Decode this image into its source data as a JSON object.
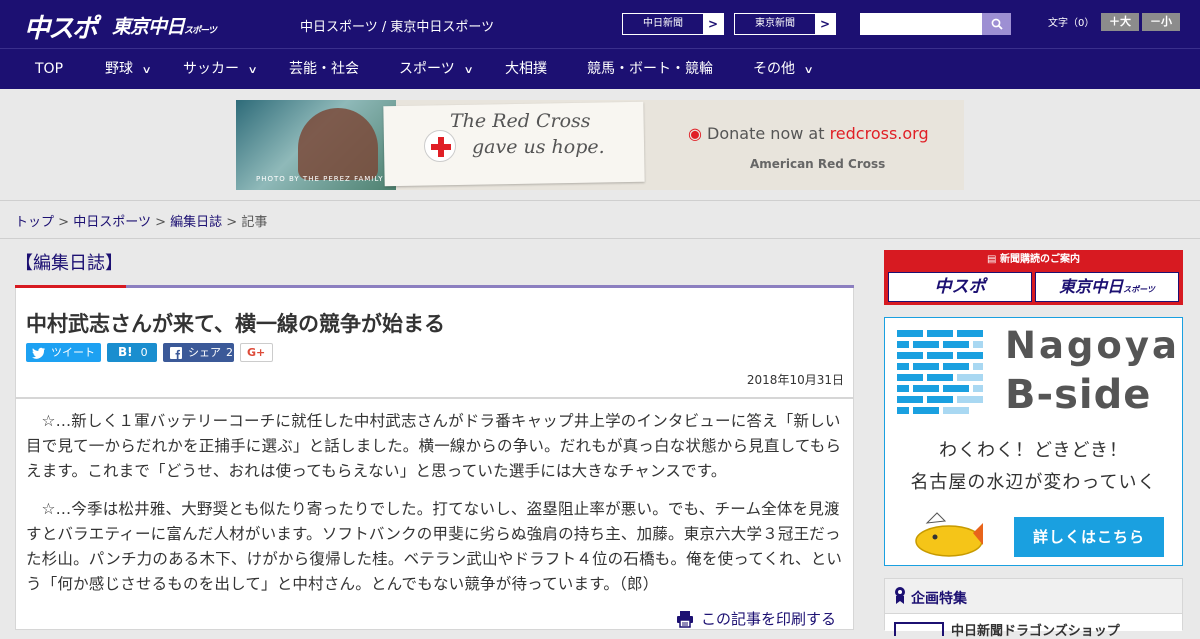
{
  "header": {
    "logo_main": "中スポ",
    "logo_tokyo": "東京中日",
    "logo_tokyo_suffix": "スポーツ",
    "site_names": "中日スポーツ / 東京中日スポーツ",
    "paper_buttons": [
      {
        "label": "中日新聞"
      },
      {
        "label": "東京新聞"
      }
    ],
    "search": {
      "placeholder": "",
      "value": ""
    },
    "font_size_label": "文字（0）",
    "font_increase": "＋大",
    "font_decrease": "－小"
  },
  "nav": {
    "items": [
      {
        "label": "TOP",
        "has_menu": false
      },
      {
        "label": "野球",
        "has_menu": true
      },
      {
        "label": "サッカー",
        "has_menu": true
      },
      {
        "label": "芸能・社会",
        "has_menu": false
      },
      {
        "label": "スポーツ",
        "has_menu": true
      },
      {
        "label": "大相撲",
        "has_menu": false
      },
      {
        "label": "競馬・ボート・競輪",
        "has_menu": false
      },
      {
        "label": "その他",
        "has_menu": true
      }
    ],
    "chevron": "∨"
  },
  "ad": {
    "photo_credit": "PHOTO BY THE PEREZ FAMILY",
    "handwriting_line1": "The Red Cross",
    "handwriting_line2": "gave us hope.",
    "donate_prefix": "Donate now at ",
    "donate_site": "redcross.org",
    "org": "American Red Cross",
    "accent": "#e01f26"
  },
  "breadcrumb": {
    "items": [
      "トップ",
      "中日スポーツ",
      "編集日誌"
    ],
    "separator": ">",
    "current": "記事"
  },
  "article": {
    "section": "【編集日誌】",
    "title": "中村武志さんが来て、横一線の競争が始まる",
    "share": {
      "tweet": "ツイート",
      "hatena": "B!",
      "hatena_count": "0",
      "facebook": "シェア",
      "facebook_count": "2",
      "gplus": "G+"
    },
    "date": "2018年10月31日",
    "paragraphs": [
      "☆…新しく１軍バッテリーコーチに就任した中村武志さんがドラ番キャップ井上学のインタビューに答え「新しい目で見て一からだれかを正捕手に選ぶ」と話しました。横一線からの争い。だれもが真っ白な状態から見直してもらえます。これまで「どうせ、おれは使ってもらえない」と思っていた選手には大きなチャンスです。",
      "☆…今季は松井雅、大野奨とも似たり寄ったりでした。打てないし、盗塁阻止率が悪い。でも、チーム全体を見渡すとバラエティーに富んだ人材がいます。ソフトバンクの甲斐に劣らぬ強肩の持ち主、加藤。東京六大学３冠王だった杉山。パンチ力のある木下、けがから復帰した桂。ベテラン武山やドラフト４位の石橋も。俺を使ってくれ、という「何か感じさせるものを出して」と中村さん。とんでもない競争が待っています。（郎）"
    ],
    "print_label": "この記事を印刷する"
  },
  "sidebar": {
    "subscription": {
      "heading": "新聞購読のご案内",
      "btn1": "中スポ",
      "btn2": "東京中日",
      "btn2_suffix": "スポーツ"
    },
    "nagoya": {
      "title1": "Nagoya",
      "title2": "B-side",
      "tagline1": "わくわく！どきどき！",
      "tagline2": "名古屋の水辺が変わっていく",
      "button": "詳しくはこちら",
      "accent": "#1aa0e0"
    },
    "feature": {
      "title": "企画特集",
      "first_item": "中日新聞ドラゴンズショップ"
    }
  },
  "colors": {
    "brand_navy": "#1c1072",
    "brand_red": "#d71a21",
    "twitter": "#1da1f2",
    "hatena": "#1a8ecf",
    "facebook": "#3b5998"
  }
}
